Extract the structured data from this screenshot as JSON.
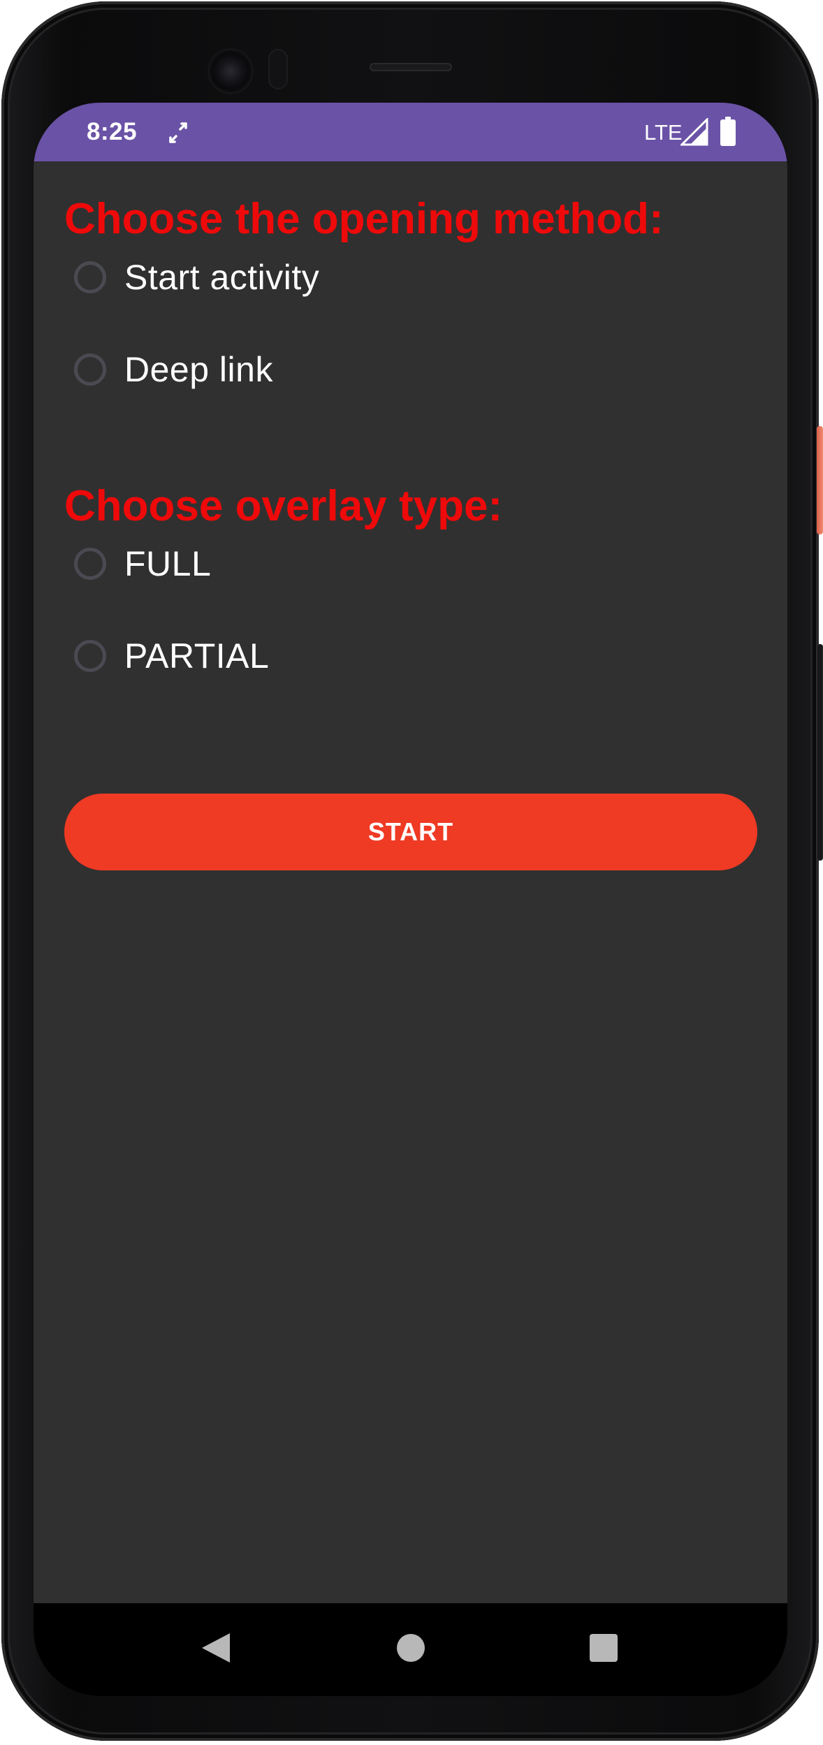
{
  "status_bar": {
    "time": "8:25",
    "network": "LTE",
    "background_color": "#6a52a6",
    "icons": [
      "sync-icon",
      "signal-icon",
      "battery-icon"
    ]
  },
  "opening_method": {
    "title": "Choose the opening method:",
    "options": [
      {
        "label": "Start activity",
        "selected": false
      },
      {
        "label": "Deep link",
        "selected": false
      }
    ]
  },
  "overlay_type": {
    "title": "Choose overlay type:",
    "options": [
      {
        "label": "FULL",
        "selected": false
      },
      {
        "label": "PARTIAL",
        "selected": false
      }
    ]
  },
  "start_button": {
    "label": "START",
    "color": "#ef3a24"
  },
  "colors": {
    "title_red": "#ee0a0a",
    "screen_background": "#303030"
  },
  "navigation": {
    "buttons": [
      "back-icon",
      "home-icon",
      "recents-icon"
    ]
  }
}
